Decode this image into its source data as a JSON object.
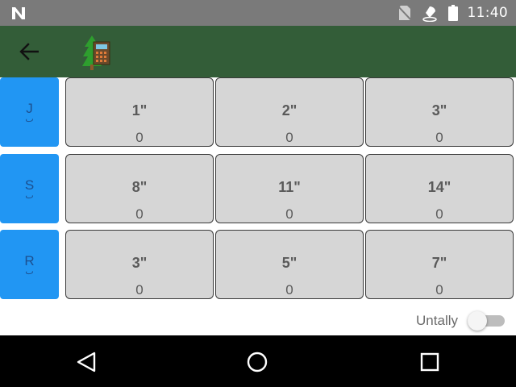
{
  "status_bar": {
    "time": "11:40",
    "icons": [
      "n-notification-icon",
      "no-sim-icon",
      "wifi-off-icon",
      "battery-icon"
    ]
  },
  "app_bar": {
    "back_icon": "arrow-left-icon",
    "logo_icon": "tree-calculator-icon"
  },
  "rows": [
    {
      "label": "J",
      "sub": "ب",
      "cells": [
        {
          "size": "1\"",
          "count": "0"
        },
        {
          "size": "2\"",
          "count": "0"
        },
        {
          "size": "3\"",
          "count": "0"
        }
      ]
    },
    {
      "label": "S",
      "sub": "ب",
      "cells": [
        {
          "size": "8\"",
          "count": "0"
        },
        {
          "size": "11\"",
          "count": "0"
        },
        {
          "size": "14\"",
          "count": "0"
        }
      ]
    },
    {
      "label": "R",
      "sub": "ٮ",
      "cells": [
        {
          "size": "3\"",
          "count": "0"
        },
        {
          "size": "5\"",
          "count": "0"
        },
        {
          "size": "7\"",
          "count": "0"
        }
      ]
    }
  ],
  "footer": {
    "toggle_label": "Untally",
    "toggle_on": false
  },
  "nav_bar": {
    "icons": [
      "back-triangle-icon",
      "home-circle-icon",
      "recents-square-icon"
    ]
  },
  "colors": {
    "status_bar": "#7a7a7a",
    "app_bar": "#335d38",
    "row_label": "#2196f3",
    "cell": "#d6d6d6",
    "nav_bar": "#000000"
  }
}
